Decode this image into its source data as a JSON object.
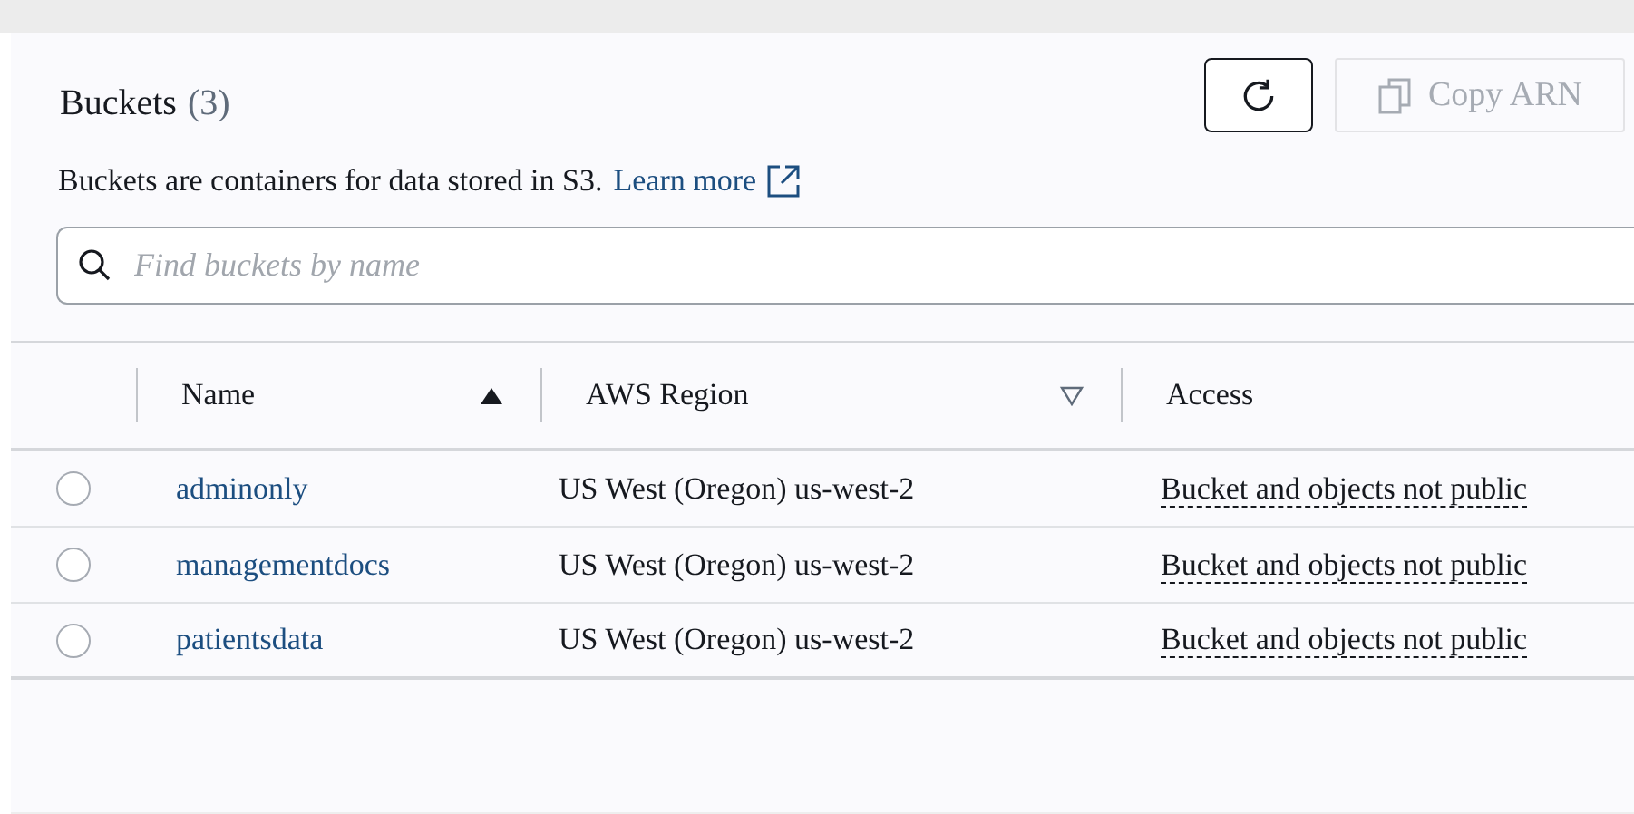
{
  "header": {
    "title": "Buckets",
    "count": "(3)",
    "description": "Buckets are containers for data stored in S3.",
    "learn_more": "Learn more",
    "copy_button": {
      "label": "Copy ARN",
      "disabled": true
    }
  },
  "search": {
    "placeholder": "Find buckets by name"
  },
  "table": {
    "columns": [
      {
        "label": "Name",
        "sorted": true
      },
      {
        "label": "AWS Region",
        "sorted": false
      },
      {
        "label": "Access"
      }
    ],
    "rows": [
      {
        "selected": false,
        "name": "adminonly",
        "region": "US West (Oregon) us-west-2",
        "access": "Bucket and objects not public"
      },
      {
        "selected": false,
        "name": "managementdocs",
        "region": "US West (Oregon) us-west-2",
        "access": "Bucket and objects not public"
      },
      {
        "selected": false,
        "name": "patientsdata",
        "region": "US West (Oregon) us-west-2",
        "access": "Bucket and objects not public"
      }
    ]
  }
}
